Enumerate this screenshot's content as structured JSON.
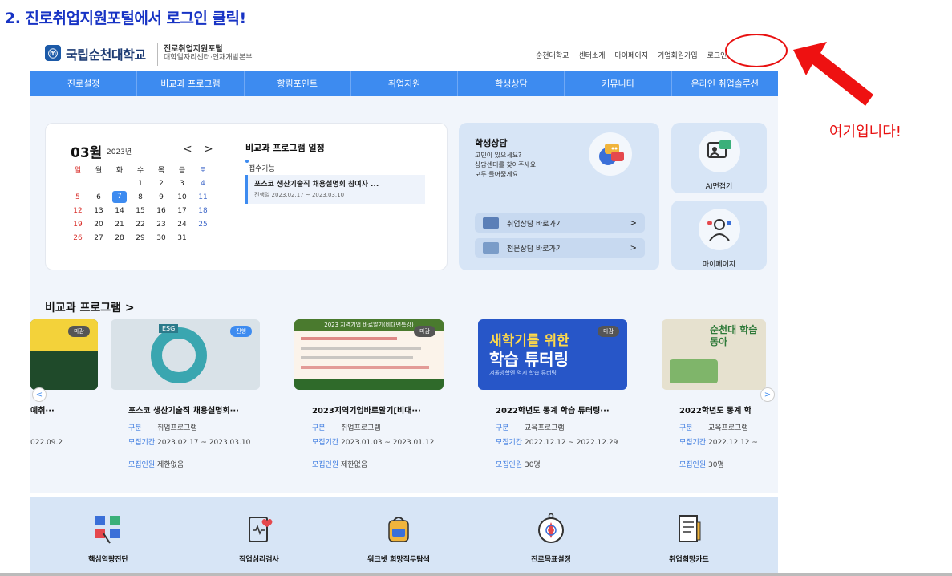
{
  "caption": "2. 진로취업지원포털에서 로그인 클릭!",
  "annotation": {
    "text": "여기입니다!",
    "color": "#e81010"
  },
  "header": {
    "university": "국립순천대학교",
    "portal_title": "진로취업지원포털",
    "portal_sub": "대학일자리센터·인재개발본부",
    "links": [
      "순천대학교",
      "센터소개",
      "마이페이지",
      "기업회원가입",
      "로그인"
    ]
  },
  "nav": [
    "진로설정",
    "비교과 프로그램",
    "향림포인트",
    "취업지원",
    "학생상담",
    "커뮤니티",
    "온라인 취업솔루션"
  ],
  "calendar": {
    "month": "03월",
    "year": "2023년",
    "weekdays": [
      "일",
      "월",
      "화",
      "수",
      "목",
      "금",
      "토"
    ],
    "weeks": [
      [
        "",
        "",
        "",
        "1",
        "2",
        "3",
        "4"
      ],
      [
        "5",
        "6",
        "7",
        "8",
        "9",
        "10",
        "11"
      ],
      [
        "12",
        "13",
        "14",
        "15",
        "16",
        "17",
        "18"
      ],
      [
        "19",
        "20",
        "21",
        "22",
        "23",
        "24",
        "25"
      ],
      [
        "26",
        "27",
        "28",
        "29",
        "30",
        "31",
        ""
      ]
    ],
    "selected": "7",
    "program_title": "비교과 프로그램 일정",
    "status": "접수가능",
    "item_name": "포스코 생산기술직 채용설명회 참여자 ...",
    "item_date": "진행일 2023.02.17 ~ 2023.03.10"
  },
  "consult": {
    "title": "학생상담",
    "desc": [
      "고민이 있으세요?",
      "상담센터를 찾아주세요",
      "모두 들어줄게요"
    ],
    "btn1": "취업상담 바로가기",
    "btn2": "전문상담 바로가기"
  },
  "side": {
    "ai": "AI면접기",
    "mypage": "마이페이지"
  },
  "programs": {
    "title": "비교과 프로그램 >",
    "cards": [
      {
        "name": "예취···",
        "badge": "마감",
        "type": "",
        "period": "022.09.2",
        "people": ""
      },
      {
        "name": "포스코 생산기술직 채용설명회···",
        "badge": "진행",
        "type": "취업프로그램",
        "period": "2023.02.17 ~ 2023.03.10",
        "people": "제한없음"
      },
      {
        "name": "2023지역기업바로알기[비대···",
        "badge": "마감",
        "type": "취업프로그램",
        "period": "2023.01.03 ~ 2023.01.12",
        "people": "제한없음"
      },
      {
        "name": "2022학년도 동계 학습 튜터링···",
        "badge": "마감",
        "type": "교육프로그램",
        "period": "2022.12.12 ~ 2022.12.29",
        "people": "30명"
      },
      {
        "name": "2022학년도 동계 학",
        "badge": "",
        "type": "교육프로그램",
        "period": "2022.12.12 ~",
        "people": "30명"
      }
    ],
    "labels": {
      "type": "구분",
      "period": "모집기간",
      "people": "모집인원"
    },
    "img_text": {
      "c2": "2023 지역기업 바로알기(비대면특강)",
      "c3a": "새학기를 위한",
      "c3b": "학습 튜터링",
      "c3c": "겨울방학엔 역시 학습 튜터링",
      "c4": "순천대 학습 동아"
    }
  },
  "tools": [
    "핵심역량진단",
    "직업심리검사",
    "워크넷 희망직무탐색",
    "진로목표설정",
    "취업희망카드"
  ]
}
